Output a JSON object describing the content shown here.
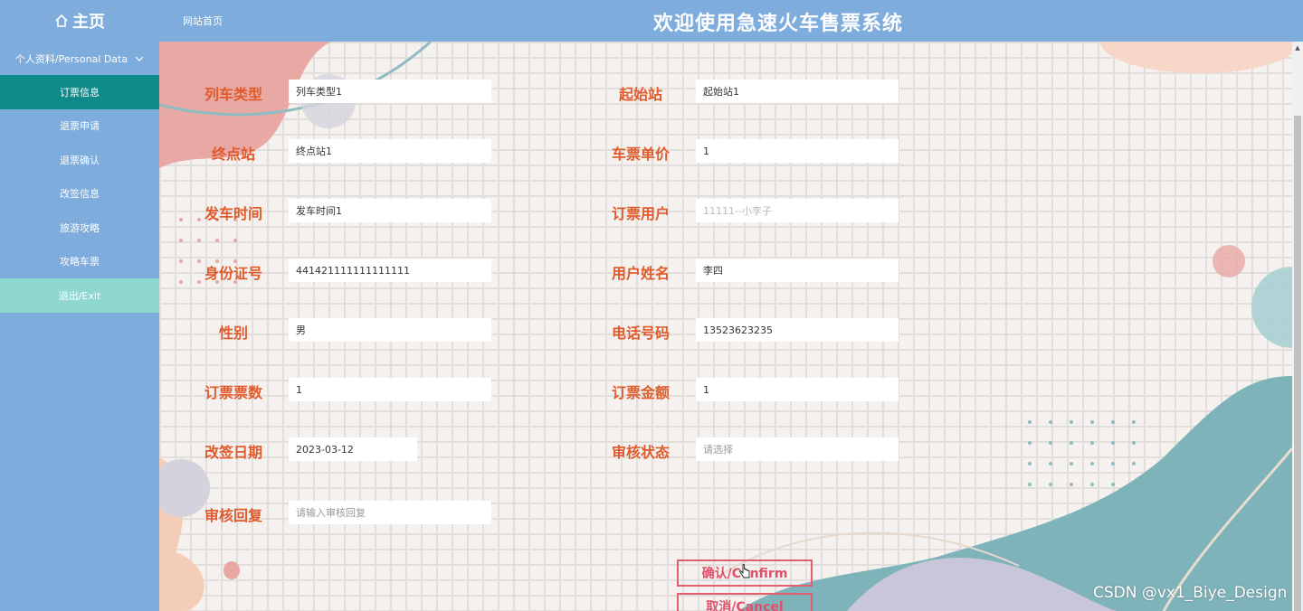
{
  "header": {
    "home_label": "主页",
    "site_link": "网站首页",
    "system_title": "欢迎使用急速火车售票系统"
  },
  "sidebar": {
    "group_label": "个人资料/Personal Data",
    "items": [
      {
        "label": "订票信息",
        "active": true
      },
      {
        "label": "退票申请"
      },
      {
        "label": "退票确认"
      },
      {
        "label": "改签信息"
      },
      {
        "label": "旅游攻略"
      },
      {
        "label": "攻略车票"
      },
      {
        "label": "退出/Exit"
      }
    ]
  },
  "form": {
    "train_type": {
      "label": "列车类型",
      "value": "列车类型1"
    },
    "start_station": {
      "label": "起始站",
      "value": "起始站1"
    },
    "end_station": {
      "label": "终点站",
      "value": "终点站1"
    },
    "ticket_price": {
      "label": "车票单价",
      "value": "1"
    },
    "depart_time": {
      "label": "发车时间",
      "value": "发车时间1"
    },
    "order_user": {
      "label": "订票用户",
      "value": "11111--小李子"
    },
    "id_number": {
      "label": "身份证号",
      "value": "441421111111111111"
    },
    "user_name": {
      "label": "用户姓名",
      "value": "李四"
    },
    "gender": {
      "label": "性别",
      "value": "男"
    },
    "phone": {
      "label": "电话号码",
      "value": "13523623235"
    },
    "ticket_count": {
      "label": "订票票数",
      "value": "1"
    },
    "amount": {
      "label": "订票金额",
      "value": "1"
    },
    "change_date": {
      "label": "改签日期",
      "value": "2023-03-12"
    },
    "audit_status": {
      "label": "审核状态",
      "placeholder": "请选择"
    },
    "audit_reply": {
      "label": "审核回复",
      "placeholder": "请输入审核回复"
    }
  },
  "buttons": {
    "confirm": "确认/Confirm",
    "cancel": "取消/Cancel"
  },
  "colors": {
    "sidebar_bg": "#7eacdc",
    "active_item": "#0e8a8a",
    "exit_item": "#8ed8d0",
    "label_color": "#e05a2c",
    "button_color": "#e0506a"
  },
  "watermark": "CSDN @vx1_Biye_Design"
}
